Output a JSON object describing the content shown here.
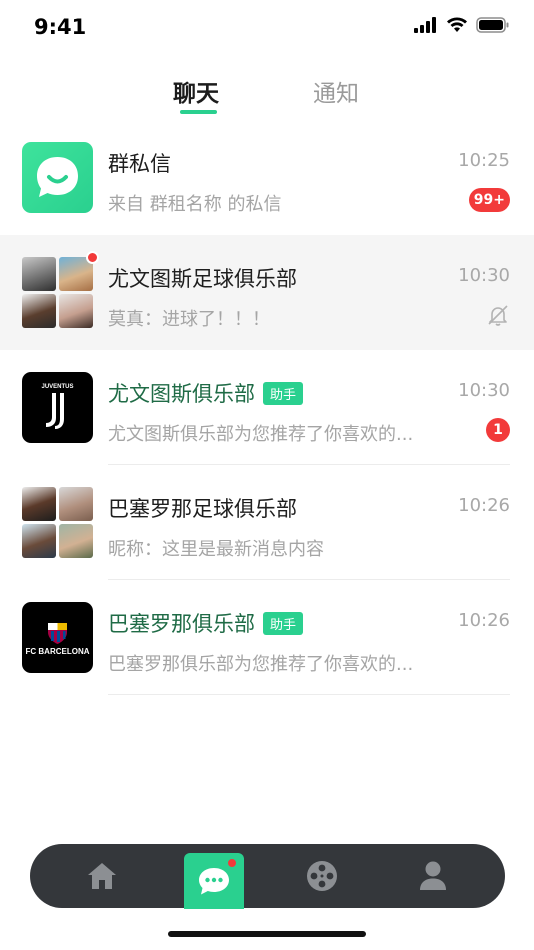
{
  "status_bar": {
    "time": "9:41"
  },
  "tabs": [
    {
      "label": "聊天",
      "active": true
    },
    {
      "label": "通知",
      "active": false
    }
  ],
  "conversations": [
    {
      "title": "群私信",
      "subtitle": "来自 群租名称 的私信",
      "time": "10:25",
      "badge": "99+",
      "avatar": "chat-bubble-logo",
      "title_color": "#1e1e1e"
    },
    {
      "title": "尤文图斯足球俱乐部",
      "subtitle": "莫真：进球了！！！",
      "time": "10:30",
      "muted": true,
      "avatar": "group-four-avatars",
      "unread_dot": true
    },
    {
      "title": "尤文图斯俱乐部",
      "tag": "助手",
      "subtitle": "尤文图斯俱乐部为您推荐了你喜欢的...",
      "time": "10:30",
      "badge": "1",
      "avatar": "juventus-logo",
      "logo_text": "JUVENTUS",
      "title_color": "#1f6b46"
    },
    {
      "title": "巴塞罗那足球俱乐部",
      "subtitle": "昵称：这里是最新消息内容",
      "time": "10:26",
      "avatar": "group-four-avatars"
    },
    {
      "title": "巴塞罗那俱乐部",
      "tag": "助手",
      "subtitle": "巴塞罗那俱乐部为您推荐了你喜欢的...",
      "time": "10:26",
      "avatar": "barcelona-logo",
      "logo_text": "FC BARCELONA",
      "title_color": "#1f6b46"
    }
  ],
  "bottom_nav": [
    {
      "icon": "home-icon"
    },
    {
      "icon": "chat-icon",
      "active": true,
      "dot": true
    },
    {
      "icon": "film-reel-icon"
    },
    {
      "icon": "profile-icon"
    }
  ],
  "colors": {
    "accent": "#2ad08f",
    "badge": "#f23a3a",
    "nav_bg": "#34373b",
    "green_title": "#1f6b46"
  }
}
